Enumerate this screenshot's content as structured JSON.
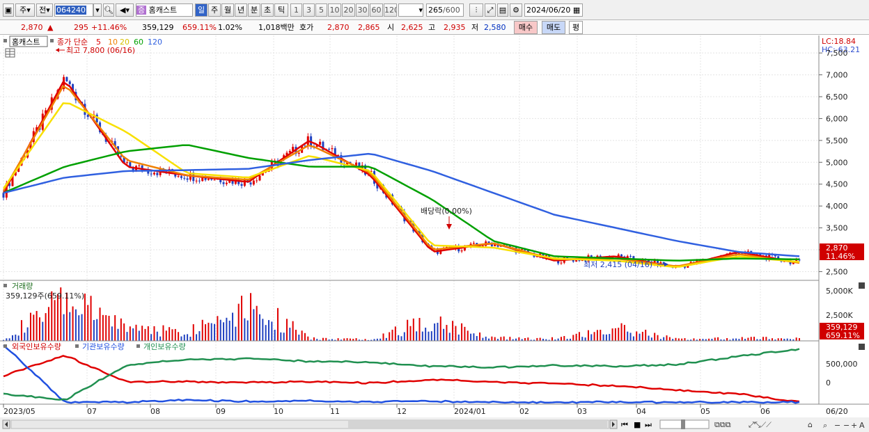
{
  "toolbar": {
    "market": "주",
    "prev": "전",
    "code": "064240",
    "stock_badge": "증",
    "stock_name": "홈캐스트",
    "periods": [
      "일",
      "주",
      "월",
      "년",
      "분",
      "초",
      "틱"
    ],
    "intervals": [
      "1",
      "3",
      "5",
      "10",
      "20",
      "30",
      "60",
      "120"
    ],
    "count": "265",
    "count_total": "/600",
    "date": "2024/06/20"
  },
  "quote": {
    "price": "2,870",
    "change": "295",
    "change_pct": "+11.46%",
    "volume": "359,129",
    "volume_pct": "659.11%",
    "turnover_pct": "1.02%",
    "amount": "1,018백만",
    "hoga_label": "호가",
    "ask": "2,870",
    "bid": "2,865",
    "open_label": "시",
    "open": "2,625",
    "high_label": "고",
    "high": "2,935",
    "low_label": "저",
    "low": "2,580",
    "buy": "매수",
    "sell": "매도",
    "eval": "평"
  },
  "price_panel": {
    "stock_tag": "홈캐스트",
    "ma_title": "종가 단순",
    "ma_periods": [
      "5",
      "10",
      "20",
      "60",
      "120"
    ],
    "lc": "LC:18.84",
    "hc": "HC:-63.21",
    "high_note": "최고 7,800 (06/16)",
    "low_note": "최저 2,415 (04/16)",
    "dividend_note": "배당락(0.00%)",
    "current_price": "2,870",
    "current_pct": "11.46%",
    "y_ticks": [
      "7,500",
      "7,000",
      "6,500",
      "6,000",
      "5,500",
      "5,000",
      "4,500",
      "4,000",
      "3,500",
      "3,000",
      "2,500"
    ]
  },
  "volume_panel": {
    "title": "거래량",
    "info": "359,129주(659.11%)",
    "y_ticks": [
      "5,000K",
      "2,500K"
    ],
    "current": "359,129",
    "current_pct": "659.11%"
  },
  "holder_panel": {
    "series": [
      "외국인보유수량",
      "기관보유수량",
      "개인보유수량"
    ],
    "y_ticks": [
      "500,000",
      "0"
    ]
  },
  "x_axis": {
    "labels": [
      "2023/05",
      "07",
      "08",
      "09",
      "10",
      "11",
      "12",
      "2024/01",
      "02",
      "03",
      "04",
      "05",
      "06"
    ],
    "right_label": "06/20"
  },
  "colors": {
    "ma5": "#e00000",
    "ma10": "#f08000",
    "ma20": "#f8e000",
    "ma60": "#00a000",
    "ma120": "#3060e0",
    "up": "#e00000",
    "down": "#2040c0",
    "foreign": "#e00000",
    "institution": "#2050e0",
    "individual": "#209050"
  },
  "chart_data": [
    {
      "type": "line",
      "title": "홈캐스트",
      "ylabel": "",
      "ylim": [
        2300,
        7900
      ],
      "x": [
        "2023/05",
        "2023/06",
        "2023/07",
        "2023/08",
        "2023/09",
        "2023/10",
        "2023/11",
        "2023/12",
        "2024/01",
        "2024/02",
        "2024/03",
        "2024/04",
        "2024/05",
        "2024/06/20"
      ],
      "series": [
        {
          "name": "5",
          "values": [
            4300,
            6900,
            4900,
            4700,
            4550,
            5500,
            4700,
            2950,
            3150,
            2750,
            2850,
            2600,
            2950,
            2700
          ]
        },
        {
          "name": "10",
          "values": [
            4350,
            6800,
            5050,
            4700,
            4600,
            5400,
            4750,
            3000,
            3150,
            2780,
            2800,
            2620,
            2900,
            2700
          ]
        },
        {
          "name": "20",
          "values": [
            4400,
            6400,
            5700,
            4750,
            4650,
            5150,
            4800,
            3100,
            3050,
            2800,
            2750,
            2600,
            2850,
            2720
          ]
        },
        {
          "name": "60",
          "values": [
            4300,
            4900,
            5250,
            5400,
            5100,
            4900,
            4900,
            4150,
            3200,
            2850,
            2800,
            2750,
            2800,
            2780
          ]
        },
        {
          "name": "120",
          "values": [
            4300,
            4650,
            4800,
            4820,
            4850,
            5050,
            5200,
            4800,
            4300,
            3800,
            3500,
            3200,
            2950,
            2850
          ]
        }
      ]
    },
    {
      "type": "bar",
      "title": "거래량",
      "ylim": [
        0,
        6000
      ],
      "categories": [
        "2023/05",
        "06",
        "07",
        "08",
        "09",
        "10",
        "11",
        "12",
        "2024/01",
        "02",
        "03",
        "04",
        "05",
        "06/20"
      ],
      "values": [
        300,
        5200,
        1900,
        1100,
        5200,
        300,
        250,
        2800,
        400,
        300,
        1600,
        250,
        350,
        359
      ]
    },
    {
      "type": "line",
      "title": "보유수량",
      "ylim": [
        -550000,
        1000000
      ],
      "x": [
        "2023/05",
        "2023/06",
        "2023/07",
        "2023/08",
        "2023/09",
        "2023/10",
        "2023/11",
        "2023/12",
        "2024/01",
        "2024/02",
        "2024/03",
        "2024/04",
        "2024/05",
        "2024/06/20"
      ],
      "series": [
        {
          "name": "외국인보유수량",
          "values": [
            150000,
            650000,
            0,
            0,
            -20000,
            0,
            -30000,
            50000,
            0,
            -50000,
            -100000,
            -200000,
            -300000,
            -500000
          ]
        },
        {
          "name": "기관보유수량",
          "values": [
            900000,
            -500000,
            -500000,
            -450000,
            -480000,
            -470000,
            -490000,
            -480000,
            -500000,
            -500000,
            -500000,
            -500000,
            -500000,
            -500000
          ]
        },
        {
          "name": "개인보유수량",
          "values": [
            -300000,
            -450000,
            400000,
            550000,
            560000,
            500000,
            480000,
            380000,
            350000,
            400000,
            380000,
            420000,
            620000,
            800000
          ]
        }
      ]
    }
  ]
}
